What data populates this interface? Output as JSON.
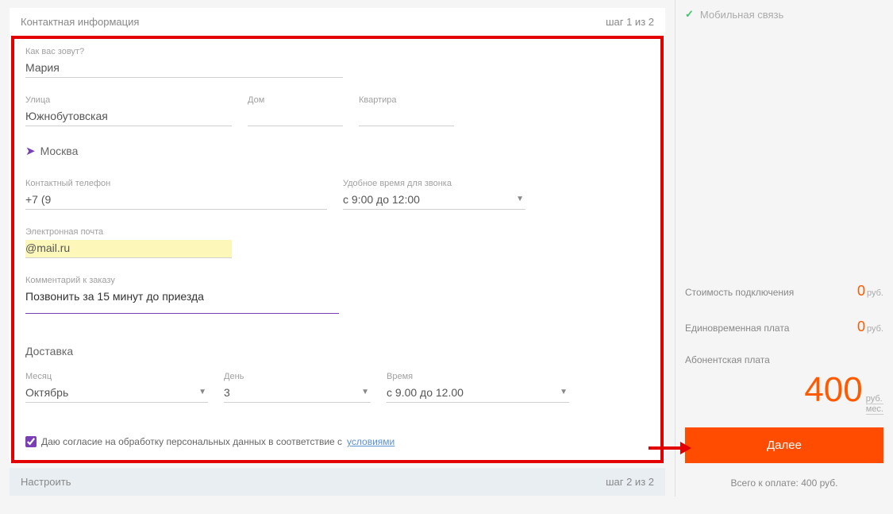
{
  "header": {
    "title": "Контактная информация",
    "step": "шаг 1 из 2"
  },
  "form": {
    "nameLabel": "Как вас зовут?",
    "nameValue": "Мария",
    "streetLabel": "Улица",
    "streetValue": "Южнобутовская",
    "houseLabel": "Дом",
    "houseValue": "",
    "aptLabel": "Квартира",
    "aptValue": "",
    "city": "Москва",
    "phoneLabel": "Контактный телефон",
    "phoneValue": "+7 (9",
    "callTimeLabel": "Удобное время для звонка",
    "callTimeValue": "с 9:00 до 12:00",
    "emailLabel": "Электронная почта",
    "emailValue": "@mail.ru",
    "commentLabel": "Комментарий к заказу",
    "commentValue": "Позвонить за 15 минут до приезда",
    "deliveryTitle": "Доставка",
    "monthLabel": "Месяц",
    "monthValue": "Октябрь",
    "dayLabel": "День",
    "dayValue": "3",
    "timeLabel": "Время",
    "timeValue": "с 9.00 до 12.00",
    "consentPrefix": "Даю согласие на обработку персональных данных в соответствие с ",
    "consentLink": "условиями"
  },
  "lower": {
    "title": "Настроить",
    "step": "шаг 2 из 2"
  },
  "summary": {
    "topLabel": "Мобильная связь",
    "row1Label": "Стоимость подключения",
    "row1Value": "0",
    "row2Label": "Единовременная плата",
    "row2Value": "0",
    "row3Label": "Абонентская плата",
    "bigValue": "400",
    "rubUnit": "руб.",
    "perMonth": "мес.",
    "nextBtn": "Далее",
    "totalLabel": "Всего к оплате: 400 руб."
  }
}
